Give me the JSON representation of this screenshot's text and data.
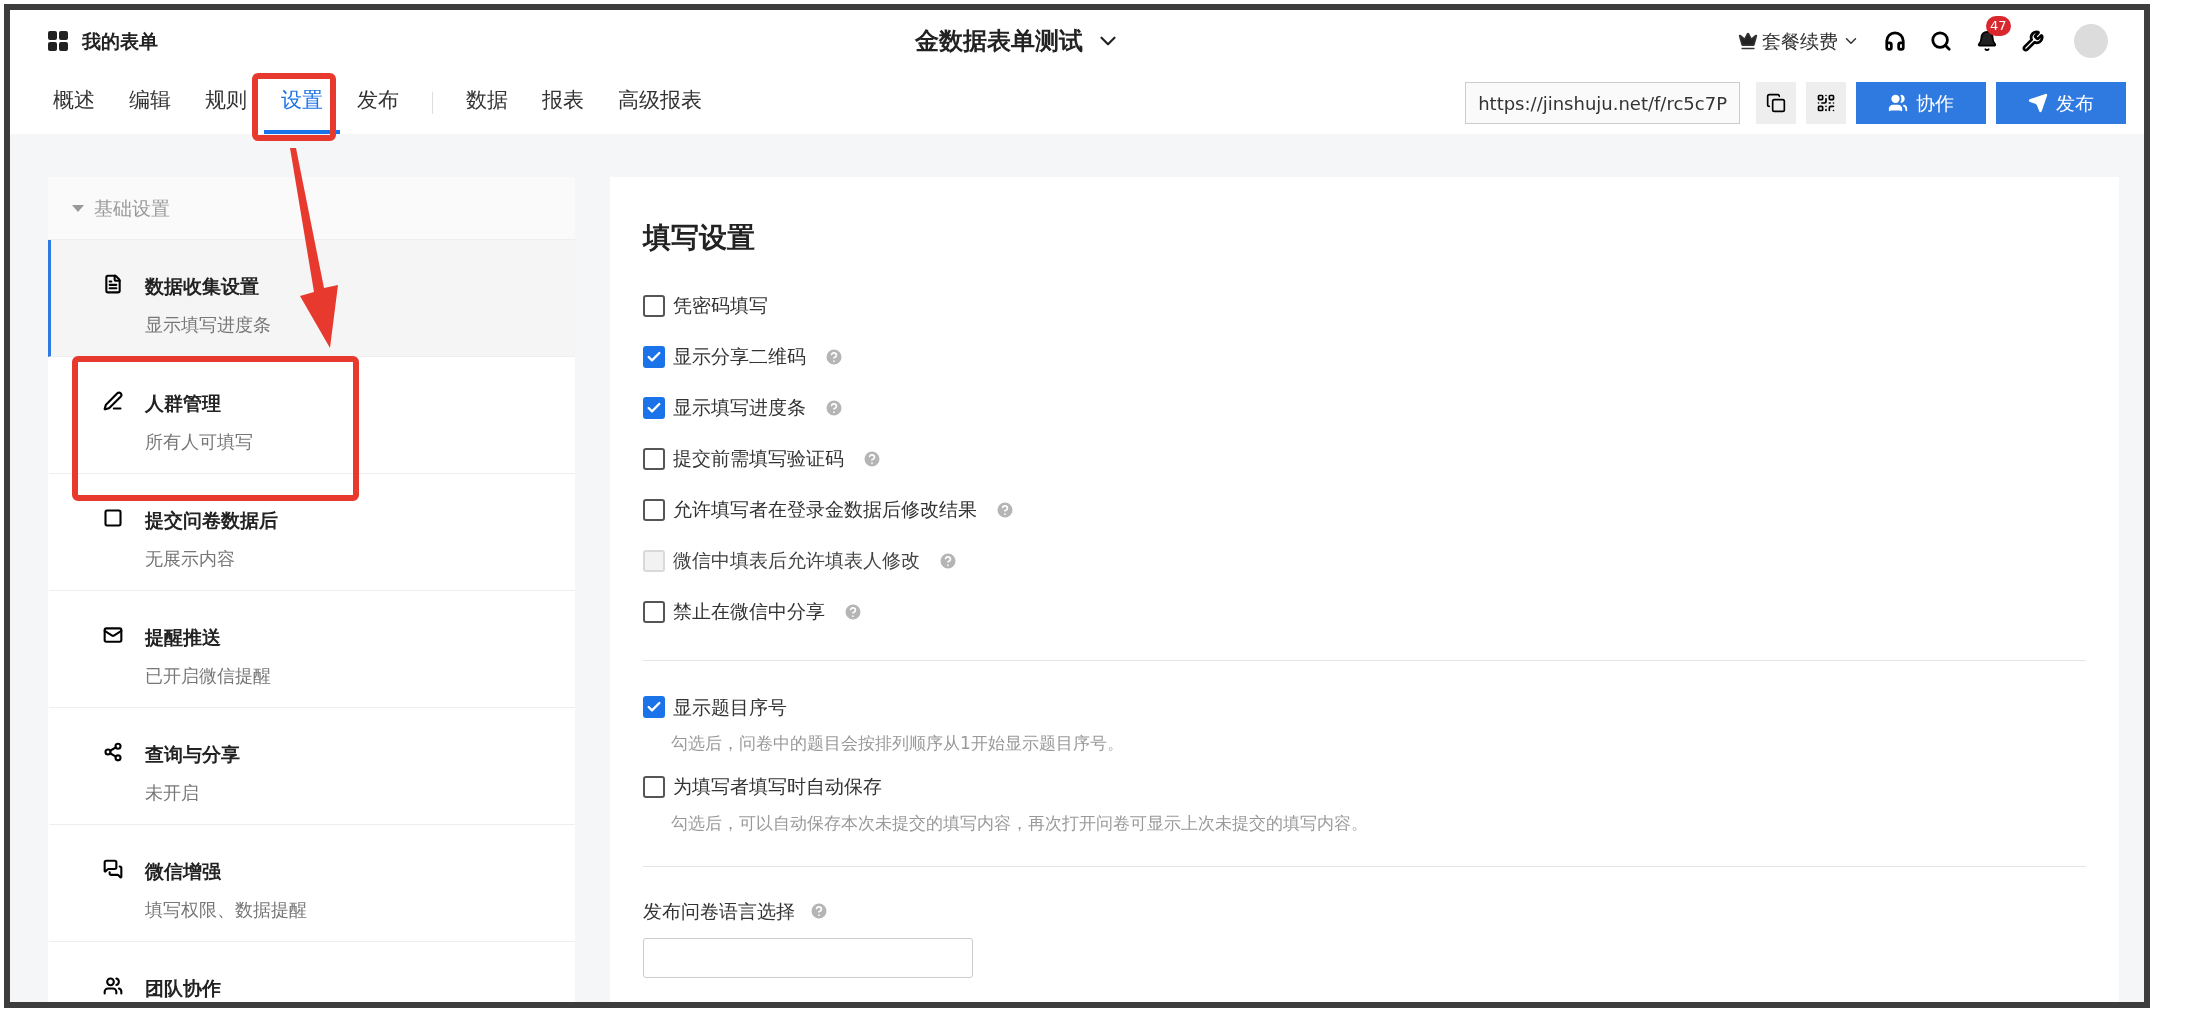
{
  "header": {
    "app_title": "我的表单",
    "form_title": "金数据表单测试",
    "renew_label": "套餐续费",
    "notification_count": "47"
  },
  "tab_groups": [
    [
      {
        "label": "概述",
        "selected": false
      },
      {
        "label": "编辑",
        "selected": false
      },
      {
        "label": "规则",
        "selected": false
      },
      {
        "label": "设置",
        "selected": true
      },
      {
        "label": "发布",
        "selected": false
      }
    ],
    [
      {
        "label": "数据",
        "selected": false
      },
      {
        "label": "报表",
        "selected": false
      },
      {
        "label": "高级报表",
        "selected": false
      }
    ]
  ],
  "share": {
    "url": "https://jinshuju.net/f/rc5c7P",
    "buttons": [
      {
        "label": "协作",
        "kind": "collab"
      },
      {
        "label": "发布",
        "kind": "publish"
      }
    ]
  },
  "sidebar": {
    "section_title": "基础设置",
    "expanded": true,
    "items": [
      {
        "title": "数据收集设置",
        "subtitle": "显示填写进度条",
        "kind": "document",
        "selected": true
      },
      {
        "title": "人群管理",
        "subtitle": "所有人可填写",
        "kind": "pen",
        "selected": false
      },
      {
        "title": "提交问卷数据后",
        "subtitle": "无展示内容",
        "kind": "square",
        "selected": false
      },
      {
        "title": "提醒推送",
        "subtitle": "已开启微信提醒",
        "kind": "mail",
        "selected": false
      },
      {
        "title": "查询与分享",
        "subtitle": "未开启",
        "kind": "share",
        "selected": false
      },
      {
        "title": "微信增强",
        "subtitle": "填写权限、数据提醒",
        "kind": "chat",
        "selected": false
      },
      {
        "title": "团队协作",
        "kind": "team",
        "selected": false
      }
    ]
  },
  "settings": {
    "title": "填写设置",
    "options": [
      {
        "label": "凭密码填写",
        "checked": false,
        "disabled": false,
        "help": false
      },
      {
        "label": "显示分享二维码",
        "checked": true,
        "disabled": false,
        "help": true
      },
      {
        "label": "显示填写进度条",
        "checked": true,
        "disabled": false,
        "help": true
      },
      {
        "label": "提交前需填写验证码",
        "checked": false,
        "disabled": false,
        "help": true
      },
      {
        "label": "允许填写者在登录金数据后修改结果",
        "checked": false,
        "disabled": false,
        "help": true
      },
      {
        "label": "微信中填表后允许填表人修改",
        "checked": false,
        "disabled": true,
        "help": true
      },
      {
        "label": "禁止在微信中分享",
        "checked": false,
        "disabled": false,
        "help": true
      }
    ],
    "display_options": [
      {
        "label": "显示题目序号",
        "checked": true,
        "hint": "勾选后，问卷中的题目会按排列顺序从1开始显示题目序号。"
      },
      {
        "label": "为填写者填写时自动保存",
        "checked": false,
        "hint": "勾选后，可以自动保存本次未提交的填写内容，再次打开问卷可显示上次未提交的填写内容。"
      }
    ],
    "language": {
      "label": "发布问卷语言选择",
      "help": true
    }
  }
}
